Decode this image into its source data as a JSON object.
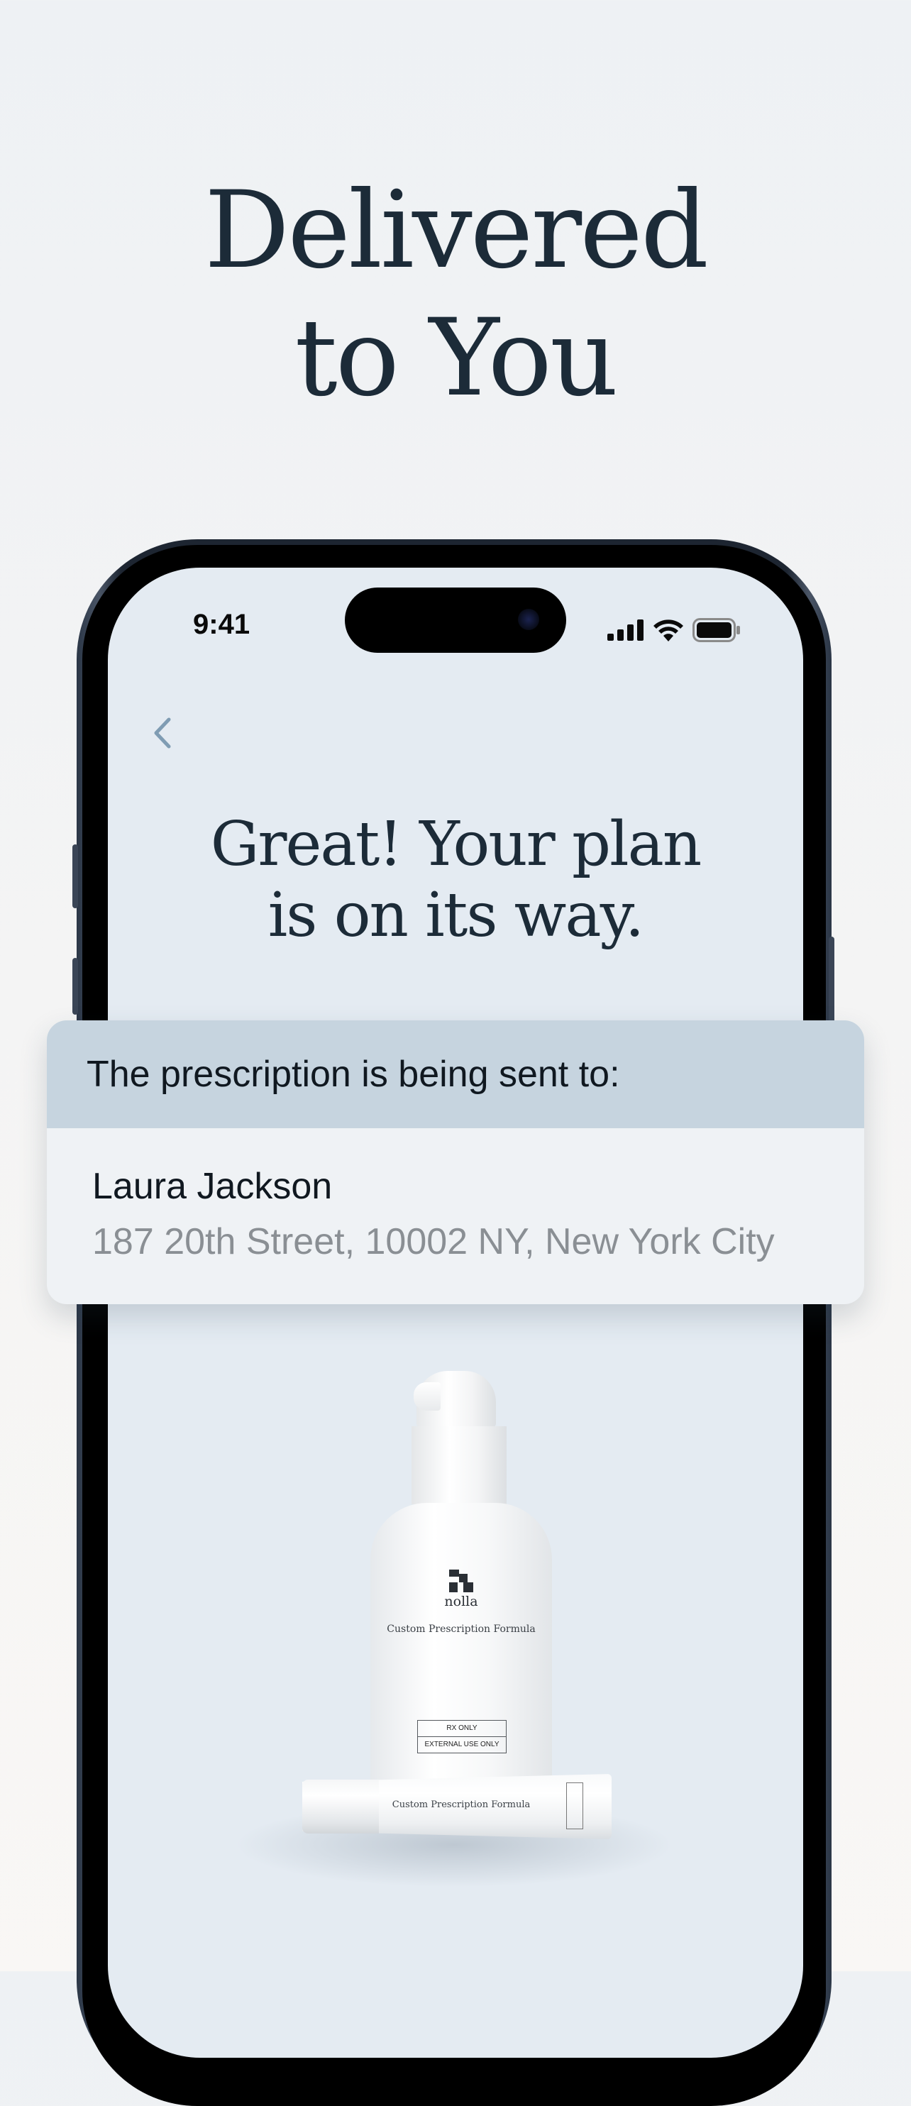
{
  "headline": {
    "line1": "Delivered",
    "line2": "to You"
  },
  "status_bar": {
    "time": "9:41"
  },
  "screen": {
    "title_line1": "Great! Your plan",
    "title_line2": "is on its way."
  },
  "card": {
    "header": "The prescription is being sent to:",
    "name": "Laura Jackson",
    "address": "187 20th Street, 10002 NY, New York City"
  },
  "product": {
    "brand": "nolla",
    "bottle_label": "Custom Prescription Formula",
    "rx_line1": "RX ONLY",
    "rx_line2": "EXTERNAL USE ONLY",
    "tube_label": "Custom Prescription Formula"
  },
  "icons": {
    "back": "chevron-left-icon",
    "signal": "cellular-signal-icon",
    "wifi": "wifi-icon",
    "battery": "battery-icon"
  },
  "colors": {
    "headline": "#1c2b38",
    "screen_bg": "#e4ebf2",
    "card_header_bg": "#c6d4df",
    "back_chevron": "#7f9cb3",
    "address_text": "#8a8f94"
  }
}
